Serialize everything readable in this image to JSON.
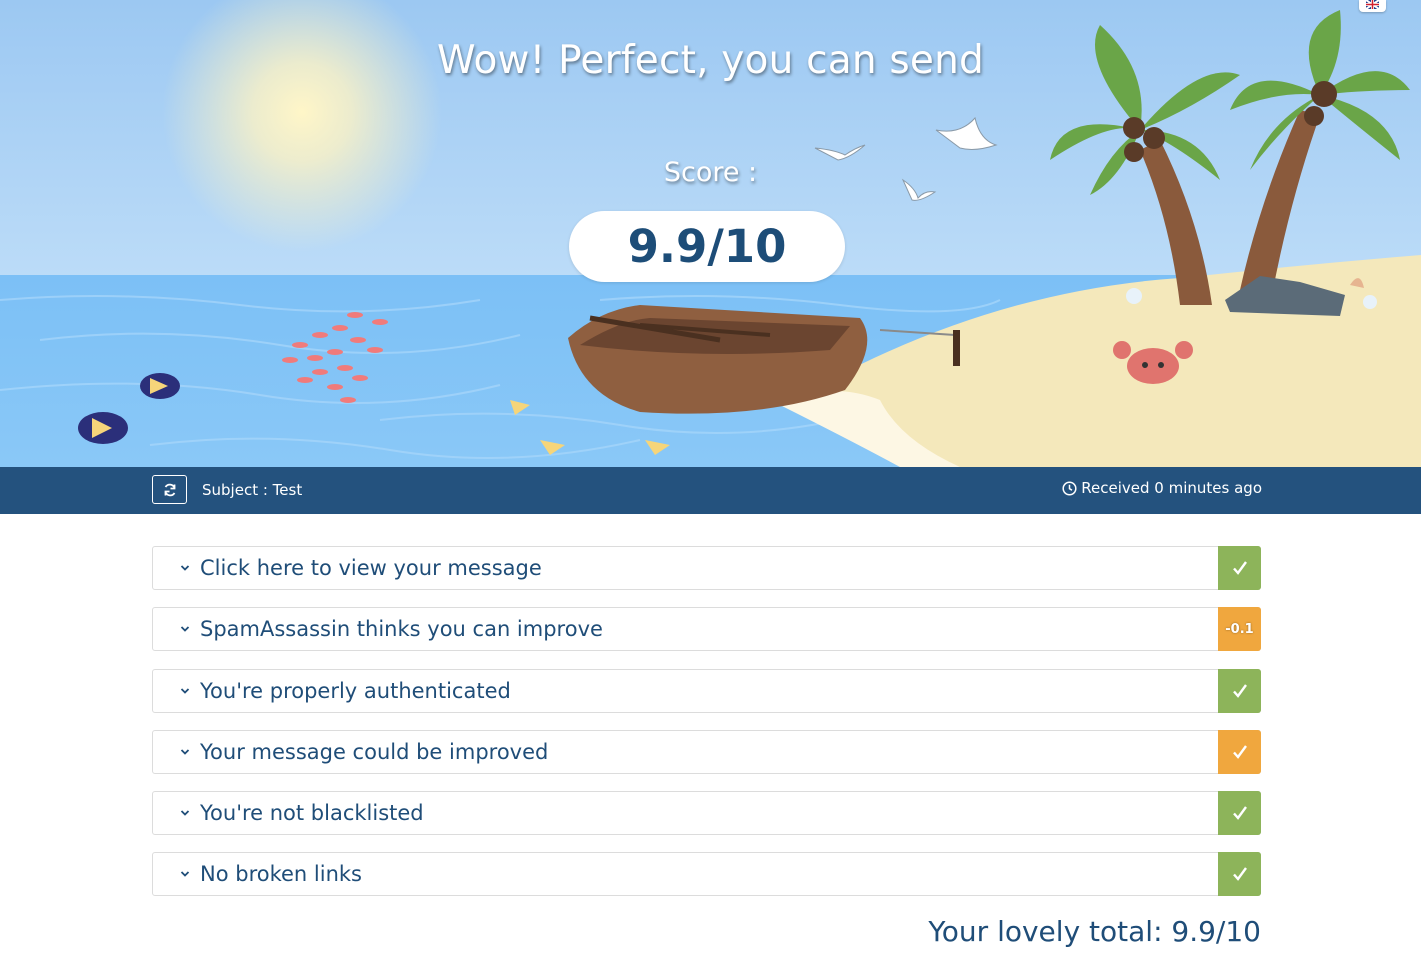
{
  "hero": {
    "title": "Wow! Perfect, you can send",
    "score_label": "Score :",
    "score_value": "9.9/10",
    "language_flag_icon": "uk-flag-icon"
  },
  "subject_bar": {
    "refresh_icon": "refresh-icon",
    "subject": "Subject : Test",
    "received_icon": "clock-icon",
    "received": "Received 0 minutes ago"
  },
  "checks": [
    {
      "label": "Click here to view your message",
      "status": "ok",
      "badge": "",
      "badge_icon": "checkmark-icon",
      "color": "#8db45a"
    },
    {
      "label": "SpamAssassin thinks you can improve",
      "status": "warn",
      "badge": "-0.1",
      "badge_icon": "",
      "color": "#f0a73e"
    },
    {
      "label": "You're properly authenticated",
      "status": "ok",
      "badge": "",
      "badge_icon": "checkmark-icon",
      "color": "#8db45a"
    },
    {
      "label": "Your message could be improved",
      "status": "warn",
      "badge": "",
      "badge_icon": "checkmark-icon",
      "color": "#f0a73e"
    },
    {
      "label": "You're not blacklisted",
      "status": "ok",
      "badge": "",
      "badge_icon": "checkmark-icon",
      "color": "#8db45a"
    },
    {
      "label": "No broken links",
      "status": "ok",
      "badge": "",
      "badge_icon": "checkmark-icon",
      "color": "#8db45a"
    }
  ],
  "total": "Your lovely total: 9.9/10",
  "colors": {
    "navy": "#24527e",
    "text_blue": "#1f4d78",
    "ok_green": "#8db45a",
    "warn_orange": "#f0a73e"
  }
}
